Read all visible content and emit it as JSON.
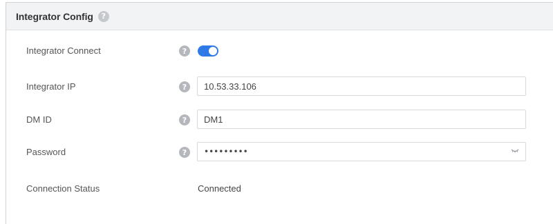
{
  "panel": {
    "title": "Integrator Config",
    "help_glyph": "?"
  },
  "rows": {
    "connect": {
      "label": "Integrator Connect",
      "toggle_on": true
    },
    "ip": {
      "label": "Integrator IP",
      "value": "10.53.33.106"
    },
    "dm_id": {
      "label": "DM ID",
      "value": "DM1"
    },
    "password": {
      "label": "Password",
      "value": "•••••••••"
    },
    "status": {
      "label": "Connection Status",
      "value": "Connected"
    }
  },
  "icons": {
    "help": "question-circle-icon",
    "password_toggle": "eye-closed-icon"
  },
  "colors": {
    "toggle_on": "#2e7be8",
    "header_bg": "#f2f3f5",
    "help_icon": "#b4b8bd"
  }
}
